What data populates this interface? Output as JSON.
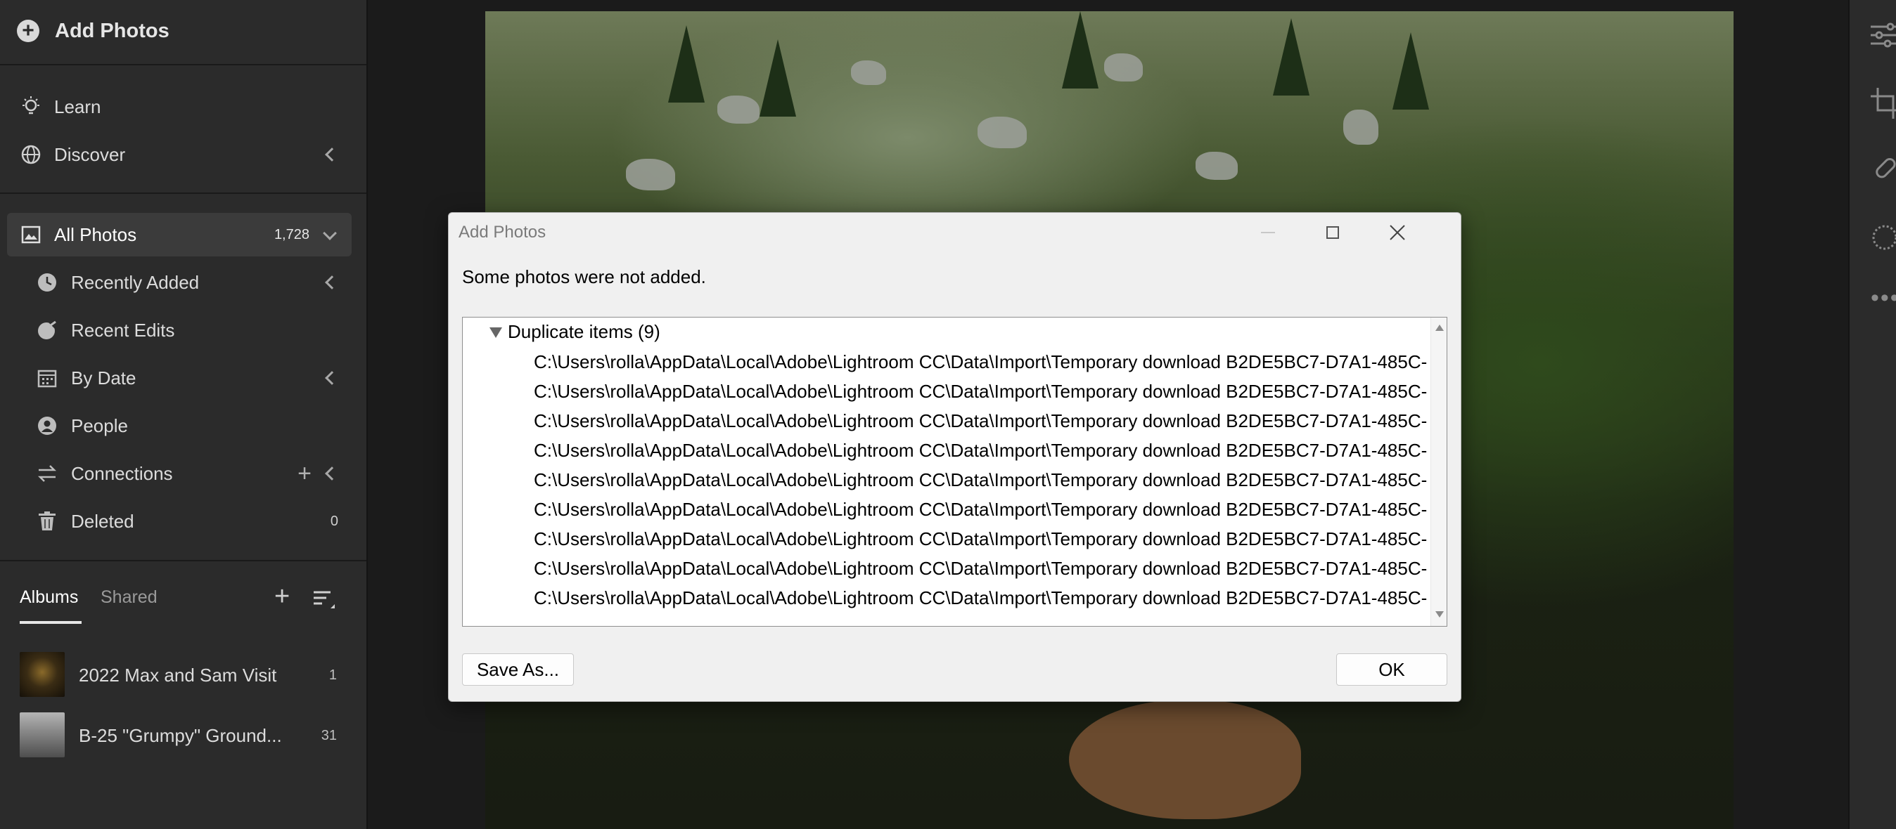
{
  "sidebar": {
    "add_photos_label": "Add Photos",
    "learn_label": "Learn",
    "discover_label": "Discover",
    "all_photos": {
      "label": "All Photos",
      "count": "1,728"
    },
    "items": [
      {
        "label": "Recently Added"
      },
      {
        "label": "Recent Edits"
      },
      {
        "label": "By Date"
      },
      {
        "label": "People"
      },
      {
        "label": "Connections"
      },
      {
        "label": "Deleted",
        "count": "0"
      }
    ],
    "tabs": {
      "albums": "Albums",
      "shared": "Shared"
    },
    "albums": [
      {
        "name": "2022 Max and Sam Visit",
        "count": "1"
      },
      {
        "name": "B-25 \"Grumpy\" Ground...",
        "count": "31"
      }
    ]
  },
  "dialog": {
    "title": "Add Photos",
    "message": "Some photos were not added.",
    "group_label": "Duplicate items (9)",
    "items": [
      "C:\\Users\\rolla\\AppData\\Local\\Adobe\\Lightroom CC\\Data\\Import\\Temporary download B2DE5BC7-D7A1-485C-",
      "C:\\Users\\rolla\\AppData\\Local\\Adobe\\Lightroom CC\\Data\\Import\\Temporary download B2DE5BC7-D7A1-485C-",
      "C:\\Users\\rolla\\AppData\\Local\\Adobe\\Lightroom CC\\Data\\Import\\Temporary download B2DE5BC7-D7A1-485C-",
      "C:\\Users\\rolla\\AppData\\Local\\Adobe\\Lightroom CC\\Data\\Import\\Temporary download B2DE5BC7-D7A1-485C-",
      "C:\\Users\\rolla\\AppData\\Local\\Adobe\\Lightroom CC\\Data\\Import\\Temporary download B2DE5BC7-D7A1-485C-",
      "C:\\Users\\rolla\\AppData\\Local\\Adobe\\Lightroom CC\\Data\\Import\\Temporary download B2DE5BC7-D7A1-485C-",
      "C:\\Users\\rolla\\AppData\\Local\\Adobe\\Lightroom CC\\Data\\Import\\Temporary download B2DE5BC7-D7A1-485C-",
      "C:\\Users\\rolla\\AppData\\Local\\Adobe\\Lightroom CC\\Data\\Import\\Temporary download B2DE5BC7-D7A1-485C-",
      "C:\\Users\\rolla\\AppData\\Local\\Adobe\\Lightroom CC\\Data\\Import\\Temporary download B2DE5BC7-D7A1-485C-"
    ],
    "save_as_label": "Save As...",
    "ok_label": "OK"
  },
  "colors": {
    "sidebar_bg": "#2b2b2b",
    "selected_row_bg": "#3b3b3b",
    "dialog_bg": "#f0f0f0"
  },
  "icons": [
    "plus-circle-icon",
    "lightbulb-icon",
    "globe-icon",
    "photos-icon",
    "clock-icon",
    "edits-icon",
    "calendar-icon",
    "person-icon",
    "connections-icon",
    "trash-icon",
    "plus-icon",
    "sort-icon",
    "sliders-icon",
    "crop-icon",
    "bandage-icon",
    "mask-icon",
    "more-icon"
  ]
}
